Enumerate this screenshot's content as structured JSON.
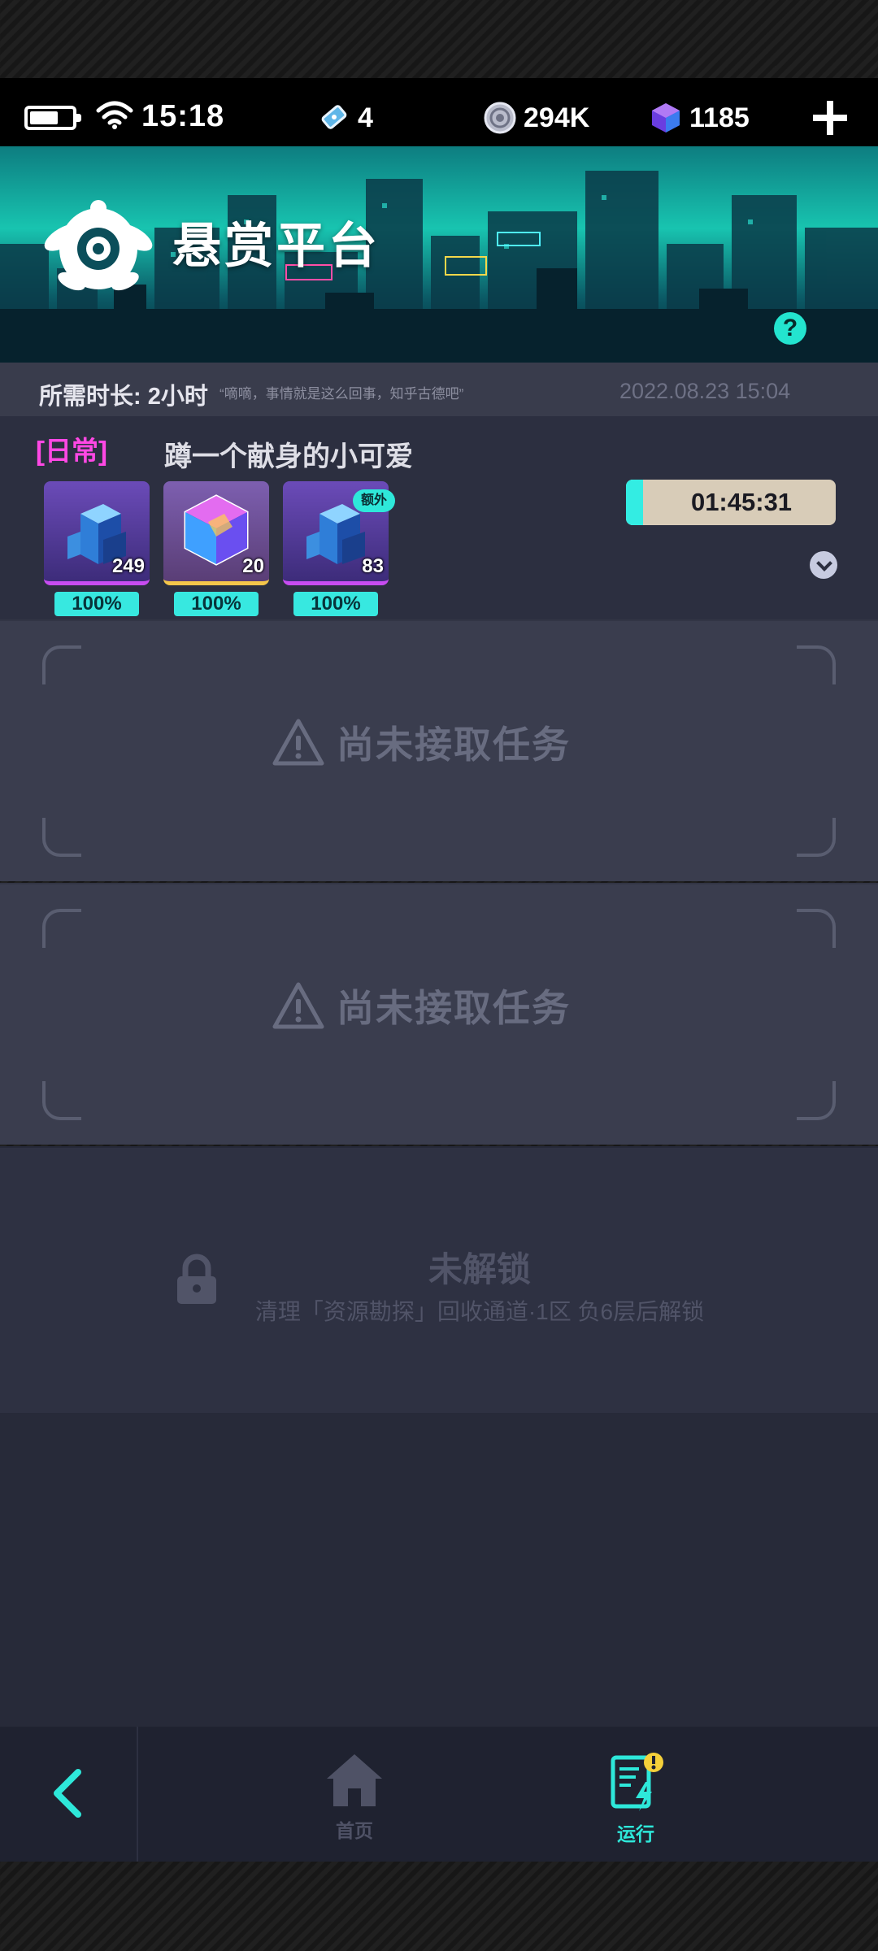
{
  "status_bar": {
    "time": "15:18",
    "resources": {
      "tickets": "4",
      "coins": "294K",
      "gems": "1185"
    }
  },
  "banner": {
    "title": "悬赏平台"
  },
  "meta": {
    "duration": "所需时长: 2小时",
    "quote": "“嘀嘀，事情就是这么回事，知乎古德吧”",
    "timestamp": "2022.08.23 15:04"
  },
  "active_task": {
    "tag": "[日常]",
    "title": "蹲一个献身的小可爱",
    "rewards": [
      {
        "count": "249",
        "chance": "100%",
        "badge": ""
      },
      {
        "count": "20",
        "chance": "100%",
        "badge": ""
      },
      {
        "count": "83",
        "chance": "100%",
        "badge": "额外"
      }
    ],
    "timer": "01:45:31",
    "timer_progress": 0.08
  },
  "empty_slots": [
    {
      "message": "尚未接取任务"
    },
    {
      "message": "尚未接取任务"
    }
  ],
  "locked_slot": {
    "title": "未解锁",
    "description": "清理「资源勘探」回收通道·1区 负6层后解锁"
  },
  "nav": {
    "home_label": "首页",
    "run_label": "运行"
  },
  "colors": {
    "accent": "#2ee8da",
    "tag": "#ff48e4",
    "timer_bg": "#d8ccb8"
  },
  "icons": [
    "battery-icon",
    "wifi-icon",
    "ticket-icon",
    "coin-icon",
    "gem-icon",
    "plus-icon",
    "turtle-logo-icon",
    "help-icon",
    "warning-icon",
    "lock-icon",
    "back-arrow-icon",
    "home-icon",
    "run-icon"
  ]
}
